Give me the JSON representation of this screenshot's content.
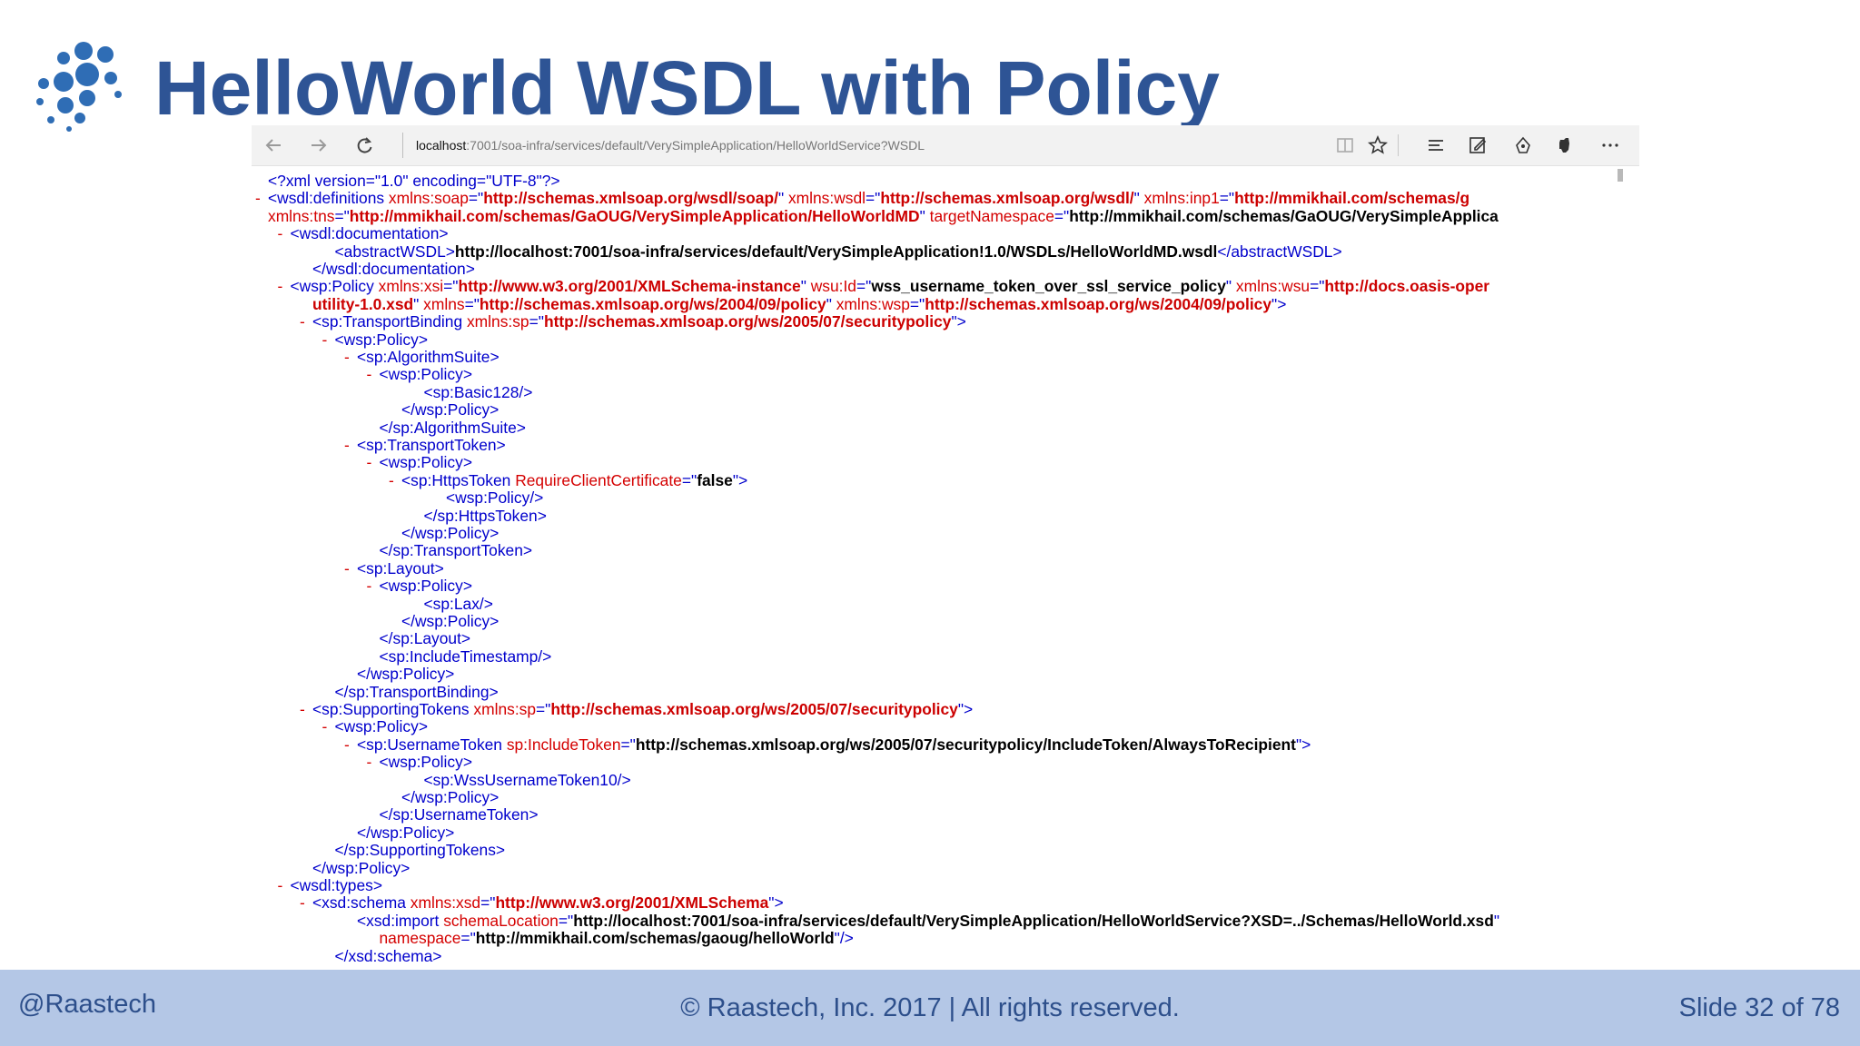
{
  "slide": {
    "title": "HelloWorld WSDL with Policy",
    "footer": {
      "left": "@Raastech",
      "center": "© Raastech, Inc. 2017  |  All rights reserved.",
      "right": "Slide 32 of 78"
    }
  },
  "browser": {
    "address": {
      "host": "localhost",
      "path": ":7001/soa-infra/services/default/VerySimpleApplication/HelloWorldService?WSDL"
    },
    "icons": [
      "back-icon",
      "forward-icon",
      "refresh-icon",
      "reading-view-icon",
      "favorite-star-icon",
      "hub-icon",
      "web-note-icon",
      "share-icon",
      "evernote-icon",
      "more-icon"
    ]
  },
  "colors": {
    "title": "#2e5495",
    "footer_bg": "#b4c7e6",
    "xml_tag": "#0000cc",
    "xml_attr_value": "#cc0000",
    "xml_toggle": "#d40000"
  },
  "xml_lines": [
    {
      "indent": 0,
      "toggle": "",
      "segments": [
        [
          "b",
          "<?"
        ],
        [
          "t",
          "xml version"
        ],
        [
          "b",
          "=\""
        ],
        [
          "t",
          "1.0"
        ],
        [
          "b",
          "\" "
        ],
        [
          "t",
          "encoding"
        ],
        [
          "b",
          "=\""
        ],
        [
          "t",
          "UTF-8"
        ],
        [
          "b",
          "\"?>"
        ]
      ]
    },
    {
      "indent": 0,
      "toggle": "-",
      "segments": [
        [
          "b",
          "<"
        ],
        [
          "t",
          "wsdl:definitions "
        ],
        [
          "a",
          "xmlns:soap"
        ],
        [
          "b",
          "=\""
        ],
        [
          "v",
          "http://schemas.xmlsoap.org/wsdl/soap/"
        ],
        [
          "b",
          "\" "
        ],
        [
          "a",
          "xmlns:wsdl"
        ],
        [
          "b",
          "=\""
        ],
        [
          "v",
          "http://schemas.xmlsoap.org/wsdl/"
        ],
        [
          "b",
          "\" "
        ],
        [
          "a",
          "xmlns:inp1"
        ],
        [
          "b",
          "=\""
        ],
        [
          "v",
          "http://mmikhail.com/schemas/g"
        ]
      ]
    },
    {
      "indent": 0,
      "toggle": "",
      "segments": [
        [
          "a",
          "xmlns:tns"
        ],
        [
          "b",
          "=\""
        ],
        [
          "v",
          "http://mmikhail.com/schemas/GaOUG/VerySimpleApplication/HelloWorldMD"
        ],
        [
          "b",
          "\" "
        ],
        [
          "a",
          "targetNamespace"
        ],
        [
          "b",
          "=\""
        ],
        [
          "x",
          "http://mmikhail.com/schemas/GaOUG/VerySimpleApplica"
        ]
      ]
    },
    {
      "indent": 1,
      "toggle": "-",
      "segments": [
        [
          "b",
          "<"
        ],
        [
          "t",
          "wsdl:documentation"
        ],
        [
          "b",
          ">"
        ]
      ]
    },
    {
      "indent": 3,
      "toggle": "",
      "segments": [
        [
          "b",
          "<"
        ],
        [
          "t",
          "abstractWSDL"
        ],
        [
          "b",
          ">"
        ],
        [
          "x",
          "http://localhost:7001/soa-infra/services/default/VerySimpleApplication!1.0/WSDLs/HelloWorldMD.wsdl"
        ],
        [
          "b",
          "</"
        ],
        [
          "t",
          "abstractWSDL"
        ],
        [
          "b",
          ">"
        ]
      ]
    },
    {
      "indent": 2,
      "toggle": "",
      "segments": [
        [
          "b",
          "</"
        ],
        [
          "t",
          "wsdl:documentation"
        ],
        [
          "b",
          ">"
        ]
      ]
    },
    {
      "indent": 1,
      "toggle": "-",
      "segments": [
        [
          "b",
          "<"
        ],
        [
          "t",
          "wsp:Policy "
        ],
        [
          "a",
          "xmlns:xsi"
        ],
        [
          "b",
          "=\""
        ],
        [
          "v",
          "http://www.w3.org/2001/XMLSchema-instance"
        ],
        [
          "b",
          "\" "
        ],
        [
          "a",
          "wsu:Id"
        ],
        [
          "b",
          "=\""
        ],
        [
          "x",
          "wss_username_token_over_ssl_service_policy"
        ],
        [
          "b",
          "\" "
        ],
        [
          "a",
          "xmlns:wsu"
        ],
        [
          "b",
          "=\""
        ],
        [
          "v",
          "http://docs.oasis-oper"
        ]
      ]
    },
    {
      "indent": 2,
      "toggle": "",
      "segments": [
        [
          "v",
          "utility-1.0.xsd"
        ],
        [
          "b",
          "\" "
        ],
        [
          "a",
          "xmlns"
        ],
        [
          "b",
          "=\""
        ],
        [
          "v",
          "http://schemas.xmlsoap.org/ws/2004/09/policy"
        ],
        [
          "b",
          "\" "
        ],
        [
          "a",
          "xmlns:wsp"
        ],
        [
          "b",
          "=\""
        ],
        [
          "v",
          "http://schemas.xmlsoap.org/ws/2004/09/policy"
        ],
        [
          "b",
          "\">"
        ]
      ]
    },
    {
      "indent": 2,
      "toggle": "-",
      "segments": [
        [
          "b",
          "<"
        ],
        [
          "t",
          "sp:TransportBinding "
        ],
        [
          "a",
          "xmlns:sp"
        ],
        [
          "b",
          "=\""
        ],
        [
          "v",
          "http://schemas.xmlsoap.org/ws/2005/07/securitypolicy"
        ],
        [
          "b",
          "\">"
        ]
      ]
    },
    {
      "indent": 3,
      "toggle": "-",
      "segments": [
        [
          "b",
          "<"
        ],
        [
          "t",
          "wsp:Policy"
        ],
        [
          "b",
          ">"
        ]
      ]
    },
    {
      "indent": 4,
      "toggle": "-",
      "segments": [
        [
          "b",
          "<"
        ],
        [
          "t",
          "sp:AlgorithmSuite"
        ],
        [
          "b",
          ">"
        ]
      ]
    },
    {
      "indent": 5,
      "toggle": "-",
      "segments": [
        [
          "b",
          "<"
        ],
        [
          "t",
          "wsp:Policy"
        ],
        [
          "b",
          ">"
        ]
      ]
    },
    {
      "indent": 7,
      "toggle": "",
      "segments": [
        [
          "b",
          "<"
        ],
        [
          "t",
          "sp:Basic128"
        ],
        [
          "b",
          "/>"
        ]
      ]
    },
    {
      "indent": 6,
      "toggle": "",
      "segments": [
        [
          "b",
          "</"
        ],
        [
          "t",
          "wsp:Policy"
        ],
        [
          "b",
          ">"
        ]
      ]
    },
    {
      "indent": 5,
      "toggle": "",
      "segments": [
        [
          "b",
          "</"
        ],
        [
          "t",
          "sp:AlgorithmSuite"
        ],
        [
          "b",
          ">"
        ]
      ]
    },
    {
      "indent": 4,
      "toggle": "-",
      "segments": [
        [
          "b",
          "<"
        ],
        [
          "t",
          "sp:TransportToken"
        ],
        [
          "b",
          ">"
        ]
      ]
    },
    {
      "indent": 5,
      "toggle": "-",
      "segments": [
        [
          "b",
          "<"
        ],
        [
          "t",
          "wsp:Policy"
        ],
        [
          "b",
          ">"
        ]
      ]
    },
    {
      "indent": 6,
      "toggle": "-",
      "segments": [
        [
          "b",
          "<"
        ],
        [
          "t",
          "sp:HttpsToken "
        ],
        [
          "a",
          "RequireClientCertificate"
        ],
        [
          "b",
          "=\""
        ],
        [
          "x",
          "false"
        ],
        [
          "b",
          "\">"
        ]
      ]
    },
    {
      "indent": 8,
      "toggle": "",
      "segments": [
        [
          "b",
          "<"
        ],
        [
          "t",
          "wsp:Policy"
        ],
        [
          "b",
          "/>"
        ]
      ]
    },
    {
      "indent": 7,
      "toggle": "",
      "segments": [
        [
          "b",
          "</"
        ],
        [
          "t",
          "sp:HttpsToken"
        ],
        [
          "b",
          ">"
        ]
      ]
    },
    {
      "indent": 6,
      "toggle": "",
      "segments": [
        [
          "b",
          "</"
        ],
        [
          "t",
          "wsp:Policy"
        ],
        [
          "b",
          ">"
        ]
      ]
    },
    {
      "indent": 5,
      "toggle": "",
      "segments": [
        [
          "b",
          "</"
        ],
        [
          "t",
          "sp:TransportToken"
        ],
        [
          "b",
          ">"
        ]
      ]
    },
    {
      "indent": 4,
      "toggle": "-",
      "segments": [
        [
          "b",
          "<"
        ],
        [
          "t",
          "sp:Layout"
        ],
        [
          "b",
          ">"
        ]
      ]
    },
    {
      "indent": 5,
      "toggle": "-",
      "segments": [
        [
          "b",
          "<"
        ],
        [
          "t",
          "wsp:Policy"
        ],
        [
          "b",
          ">"
        ]
      ]
    },
    {
      "indent": 7,
      "toggle": "",
      "segments": [
        [
          "b",
          "<"
        ],
        [
          "t",
          "sp:Lax"
        ],
        [
          "b",
          "/>"
        ]
      ]
    },
    {
      "indent": 6,
      "toggle": "",
      "segments": [
        [
          "b",
          "</"
        ],
        [
          "t",
          "wsp:Policy"
        ],
        [
          "b",
          ">"
        ]
      ]
    },
    {
      "indent": 5,
      "toggle": "",
      "segments": [
        [
          "b",
          "</"
        ],
        [
          "t",
          "sp:Layout"
        ],
        [
          "b",
          ">"
        ]
      ]
    },
    {
      "indent": 5,
      "toggle": "",
      "segments": [
        [
          "b",
          "<"
        ],
        [
          "t",
          "sp:IncludeTimestamp"
        ],
        [
          "b",
          "/>"
        ]
      ]
    },
    {
      "indent": 4,
      "toggle": "",
      "segments": [
        [
          "b",
          "</"
        ],
        [
          "t",
          "wsp:Policy"
        ],
        [
          "b",
          ">"
        ]
      ]
    },
    {
      "indent": 3,
      "toggle": "",
      "segments": [
        [
          "b",
          "</"
        ],
        [
          "t",
          "sp:TransportBinding"
        ],
        [
          "b",
          ">"
        ]
      ]
    },
    {
      "indent": 2,
      "toggle": "-",
      "segments": [
        [
          "b",
          "<"
        ],
        [
          "t",
          "sp:SupportingTokens "
        ],
        [
          "a",
          "xmlns:sp"
        ],
        [
          "b",
          "=\""
        ],
        [
          "v",
          "http://schemas.xmlsoap.org/ws/2005/07/securitypolicy"
        ],
        [
          "b",
          "\">"
        ]
      ]
    },
    {
      "indent": 3,
      "toggle": "-",
      "segments": [
        [
          "b",
          "<"
        ],
        [
          "t",
          "wsp:Policy"
        ],
        [
          "b",
          ">"
        ]
      ]
    },
    {
      "indent": 4,
      "toggle": "-",
      "segments": [
        [
          "b",
          "<"
        ],
        [
          "t",
          "sp:UsernameToken "
        ],
        [
          "a",
          "sp:IncludeToken"
        ],
        [
          "b",
          "=\""
        ],
        [
          "x",
          "http://schemas.xmlsoap.org/ws/2005/07/securitypolicy/IncludeToken/AlwaysToRecipient"
        ],
        [
          "b",
          "\">"
        ]
      ]
    },
    {
      "indent": 5,
      "toggle": "-",
      "segments": [
        [
          "b",
          "<"
        ],
        [
          "t",
          "wsp:Policy"
        ],
        [
          "b",
          ">"
        ]
      ]
    },
    {
      "indent": 7,
      "toggle": "",
      "segments": [
        [
          "b",
          "<"
        ],
        [
          "t",
          "sp:WssUsernameToken10"
        ],
        [
          "b",
          "/>"
        ]
      ]
    },
    {
      "indent": 6,
      "toggle": "",
      "segments": [
        [
          "b",
          "</"
        ],
        [
          "t",
          "wsp:Policy"
        ],
        [
          "b",
          ">"
        ]
      ]
    },
    {
      "indent": 5,
      "toggle": "",
      "segments": [
        [
          "b",
          "</"
        ],
        [
          "t",
          "sp:UsernameToken"
        ],
        [
          "b",
          ">"
        ]
      ]
    },
    {
      "indent": 4,
      "toggle": "",
      "segments": [
        [
          "b",
          "</"
        ],
        [
          "t",
          "wsp:Policy"
        ],
        [
          "b",
          ">"
        ]
      ]
    },
    {
      "indent": 3,
      "toggle": "",
      "segments": [
        [
          "b",
          "</"
        ],
        [
          "t",
          "sp:SupportingTokens"
        ],
        [
          "b",
          ">"
        ]
      ]
    },
    {
      "indent": 2,
      "toggle": "",
      "segments": [
        [
          "b",
          "</"
        ],
        [
          "t",
          "wsp:Policy"
        ],
        [
          "b",
          ">"
        ]
      ]
    },
    {
      "indent": 1,
      "toggle": "-",
      "segments": [
        [
          "b",
          "<"
        ],
        [
          "t",
          "wsdl:types"
        ],
        [
          "b",
          ">"
        ]
      ]
    },
    {
      "indent": 2,
      "toggle": "-",
      "segments": [
        [
          "b",
          "<"
        ],
        [
          "t",
          "xsd:schema "
        ],
        [
          "a",
          "xmlns:xsd"
        ],
        [
          "b",
          "=\""
        ],
        [
          "v",
          "http://www.w3.org/2001/XMLSchema"
        ],
        [
          "b",
          "\">"
        ]
      ]
    },
    {
      "indent": 4,
      "toggle": "",
      "segments": [
        [
          "b",
          "<"
        ],
        [
          "t",
          "xsd:import "
        ],
        [
          "a",
          "schemaLocation"
        ],
        [
          "b",
          "=\""
        ],
        [
          "x",
          "http://localhost:7001/soa-infra/services/default/VerySimpleApplication/HelloWorldService?XSD=../Schemas/HelloWorld.xsd"
        ],
        [
          "b",
          "\""
        ]
      ]
    },
    {
      "indent": 5,
      "toggle": "",
      "segments": [
        [
          "a",
          "namespace"
        ],
        [
          "b",
          "=\""
        ],
        [
          "x",
          "http://mmikhail.com/schemas/gaoug/helloWorld"
        ],
        [
          "b",
          "\"/>"
        ]
      ]
    },
    {
      "indent": 3,
      "toggle": "",
      "segments": [
        [
          "b",
          "</"
        ],
        [
          "t",
          "xsd:schema"
        ],
        [
          "b",
          ">"
        ]
      ]
    }
  ]
}
